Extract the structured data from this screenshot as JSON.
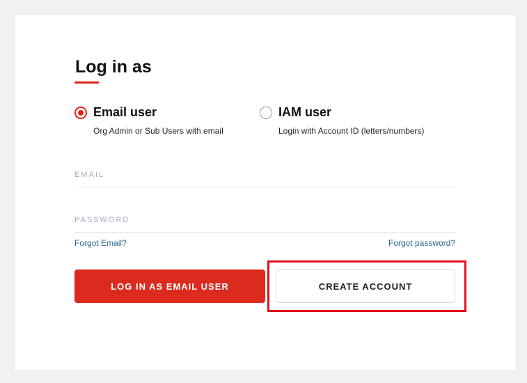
{
  "login": {
    "title": "Log in as",
    "options": [
      {
        "label": "Email user",
        "description": "Org Admin or Sub Users with email",
        "selected": true
      },
      {
        "label": "IAM user",
        "description": "Login with Account ID (letters/numbers)",
        "selected": false
      }
    ],
    "email_field": {
      "placeholder": "EMAIL",
      "value": ""
    },
    "password_field": {
      "placeholder": "PASSWORD",
      "value": ""
    },
    "forgot_email": "Forgot Email?",
    "forgot_password": "Forgot password?",
    "login_button": "LOG IN AS EMAIL USER",
    "create_account_button": "CREATE ACCOUNT"
  },
  "colors": {
    "accent": "#e0231a",
    "button_primary": "#db2b1f",
    "link": "#2d6a8f",
    "highlight": "#e0101a"
  },
  "icons": {
    "email_radio": "radio-checked-icon",
    "iam_radio": "radio-unchecked-icon"
  }
}
